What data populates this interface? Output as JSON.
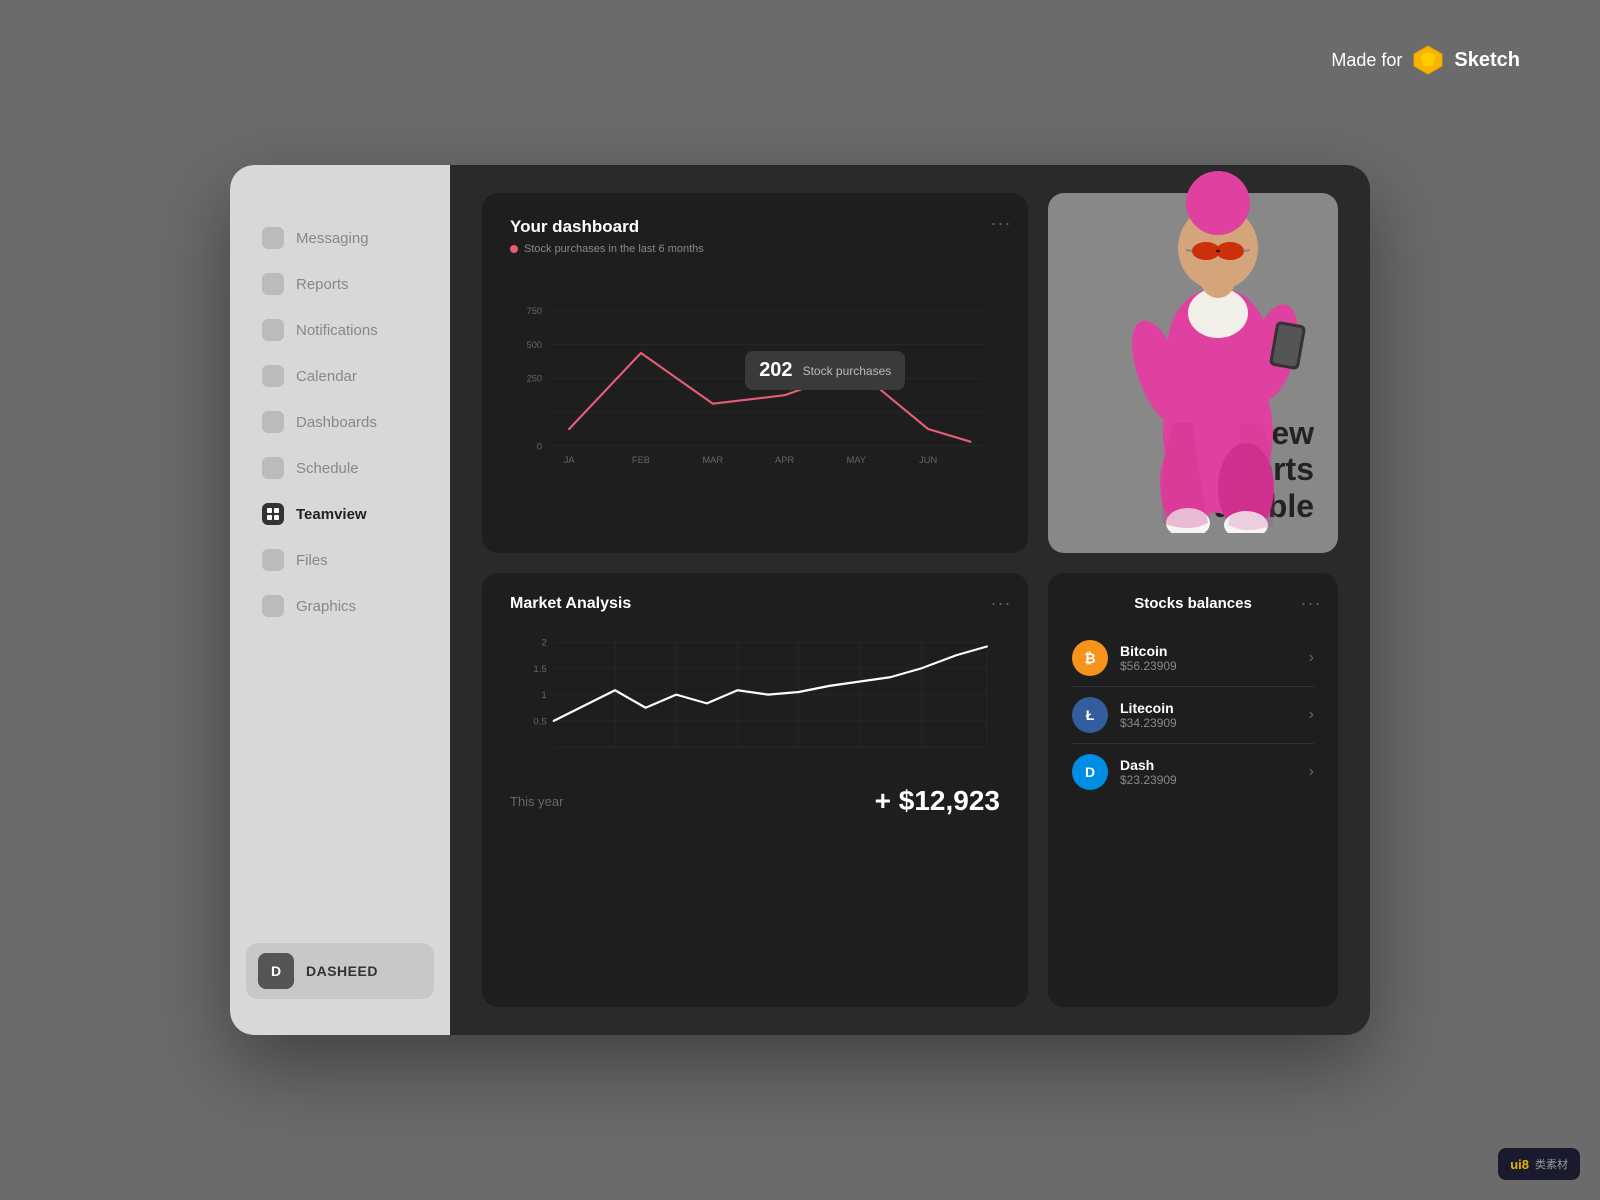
{
  "badge": {
    "made_for": "Made for",
    "sketch": "Sketch"
  },
  "sidebar": {
    "items": [
      {
        "id": "messaging",
        "label": "Messaging",
        "icon": "message-icon",
        "active": false
      },
      {
        "id": "reports",
        "label": "Reports",
        "icon": "reports-icon",
        "active": false
      },
      {
        "id": "notifications",
        "label": "Notifications",
        "icon": "bell-icon",
        "active": false
      },
      {
        "id": "calendar",
        "label": "Calendar",
        "icon": "calendar-icon",
        "active": false
      },
      {
        "id": "dashboards",
        "label": "Dashboards",
        "icon": "dashboard-icon",
        "active": false
      },
      {
        "id": "schedule",
        "label": "Schedule",
        "icon": "schedule-icon",
        "active": false
      },
      {
        "id": "teamview",
        "label": "Teamview",
        "icon": "grid-icon",
        "active": true
      },
      {
        "id": "files",
        "label": "Files",
        "icon": "files-icon",
        "active": false
      },
      {
        "id": "graphics",
        "label": "Graphics",
        "icon": "graphics-icon",
        "active": false
      }
    ],
    "user": {
      "avatar": "D",
      "name": "DASHEED"
    }
  },
  "dashboard_card": {
    "title": "Your dashboard",
    "legend": "Stock purchases in the last 6 months",
    "menu": "...",
    "tooltip": {
      "number": "202",
      "label": "Stock purchases"
    },
    "y_axis": [
      "750",
      "500",
      "250",
      "0"
    ],
    "x_axis": [
      "JA",
      "FEB",
      "MAR",
      "APR",
      "MAY",
      "JUN"
    ]
  },
  "promo_card": {
    "line1": "New",
    "line2": "reports",
    "line3": "available"
  },
  "market_card": {
    "title": "Market Analysis",
    "period": "This year",
    "value": "+ $12,923",
    "menu": "...",
    "y_axis": [
      "2",
      "1.5",
      "1",
      "0.5"
    ]
  },
  "stocks_card": {
    "title": "Stocks balances",
    "menu": "...",
    "items": [
      {
        "id": "bitcoin",
        "name": "Bitcoin",
        "price": "$56.23909",
        "symbol": "₿",
        "class": "bitcoin"
      },
      {
        "id": "litecoin",
        "name": "Litecoin",
        "price": "$34.23909",
        "symbol": "Ł",
        "class": "litecoin"
      },
      {
        "id": "dash",
        "name": "Dash",
        "price": "$23.23909",
        "symbol": "D",
        "class": "dash"
      }
    ]
  },
  "watermark": {
    "icon": "ui8",
    "text": "ui8.类",
    "sub": "素材"
  }
}
